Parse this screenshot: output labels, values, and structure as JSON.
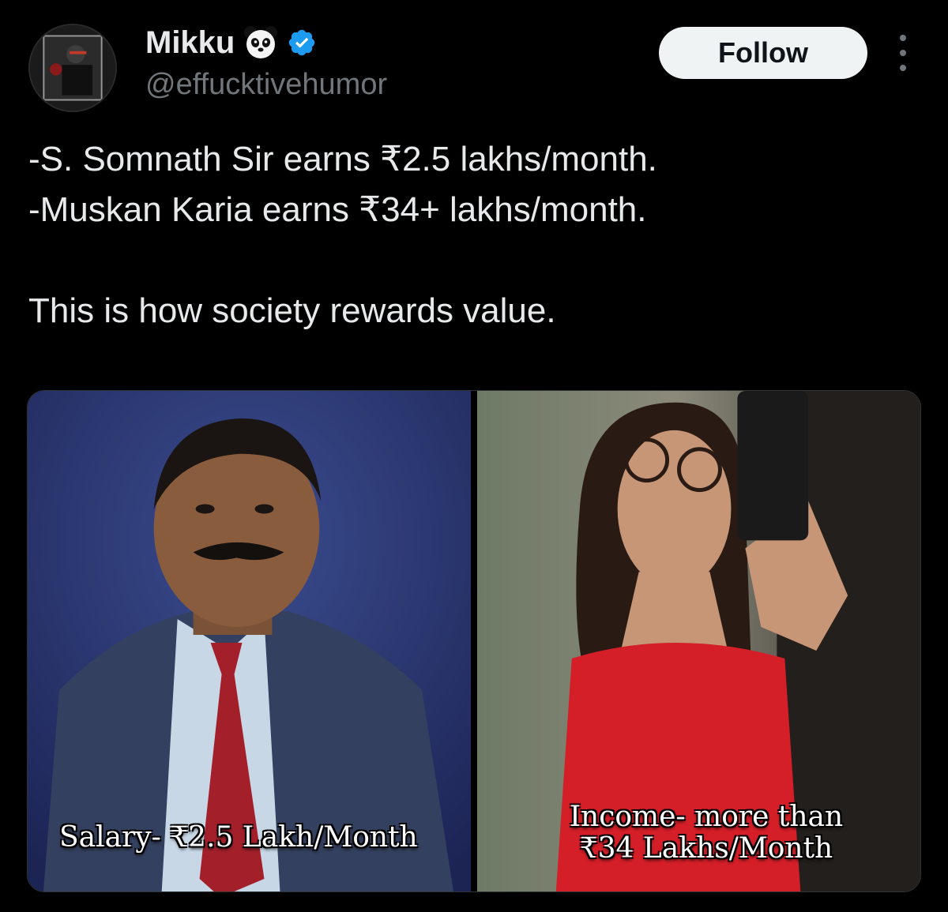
{
  "author": {
    "display_name": "Mikku",
    "handle": "@effucktivehumor",
    "emoji_icon": "panda-face-icon",
    "verified_icon": "verified-badge-icon",
    "verified_color": "#1d9bf0"
  },
  "actions": {
    "follow_label": "Follow",
    "more_icon": "more-vertical-icon"
  },
  "tweet": {
    "text": "-S. Somnath Sir earns ₹2.5 lakhs/month.\n-Muskan Karia earns ₹34+ lakhs/month.\n\nThis is how society rewards value."
  },
  "media": {
    "left_caption": "Salary- ₹2.5 Lakh/Month",
    "right_caption_line1": "Income- more than",
    "right_caption_line2": "₹34 Lakhs/Month"
  },
  "colors": {
    "background": "#000000",
    "text_primary": "#e7e9ea",
    "text_secondary": "#71767b",
    "button_bg": "#eff3f4",
    "button_text": "#0f1419"
  }
}
